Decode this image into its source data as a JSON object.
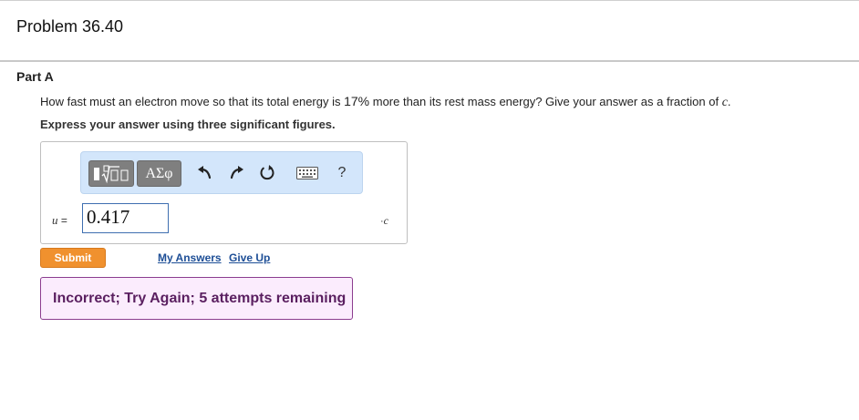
{
  "problem": {
    "title": "Problem 36.40"
  },
  "part": {
    "label": "Part A",
    "question_pre": "How fast must an electron move so that its total energy is ",
    "question_percent": "17%",
    "question_mid": " more than its rest mass energy? Give your answer as a fraction of ",
    "question_var": "c",
    "question_end": ".",
    "instruction": "Express your answer using three significant figures."
  },
  "toolbar": {
    "templates_icon": "templates-icon",
    "greek_label": "ΑΣφ",
    "undo_icon": "undo-icon",
    "redo_icon": "redo-icon",
    "reset_icon": "reset-icon",
    "keyboard_icon": "keyboard-icon",
    "help_label": "?"
  },
  "answer": {
    "variable": "u",
    "equals": "=",
    "value": "0.417",
    "unit_prefix": "·",
    "unit_var": "c"
  },
  "actions": {
    "submit_label": "Submit",
    "my_answers_label": "My Answers",
    "give_up_label": "Give Up"
  },
  "feedback": {
    "message": "Incorrect; Try Again; 5 attempts remaining"
  },
  "colors": {
    "submit": "#f0912e",
    "toolbar_bg": "#d3e6fb",
    "feedback_bg": "#fbecfd",
    "feedback_border": "#8b3c8f",
    "link": "#1d4e96"
  }
}
